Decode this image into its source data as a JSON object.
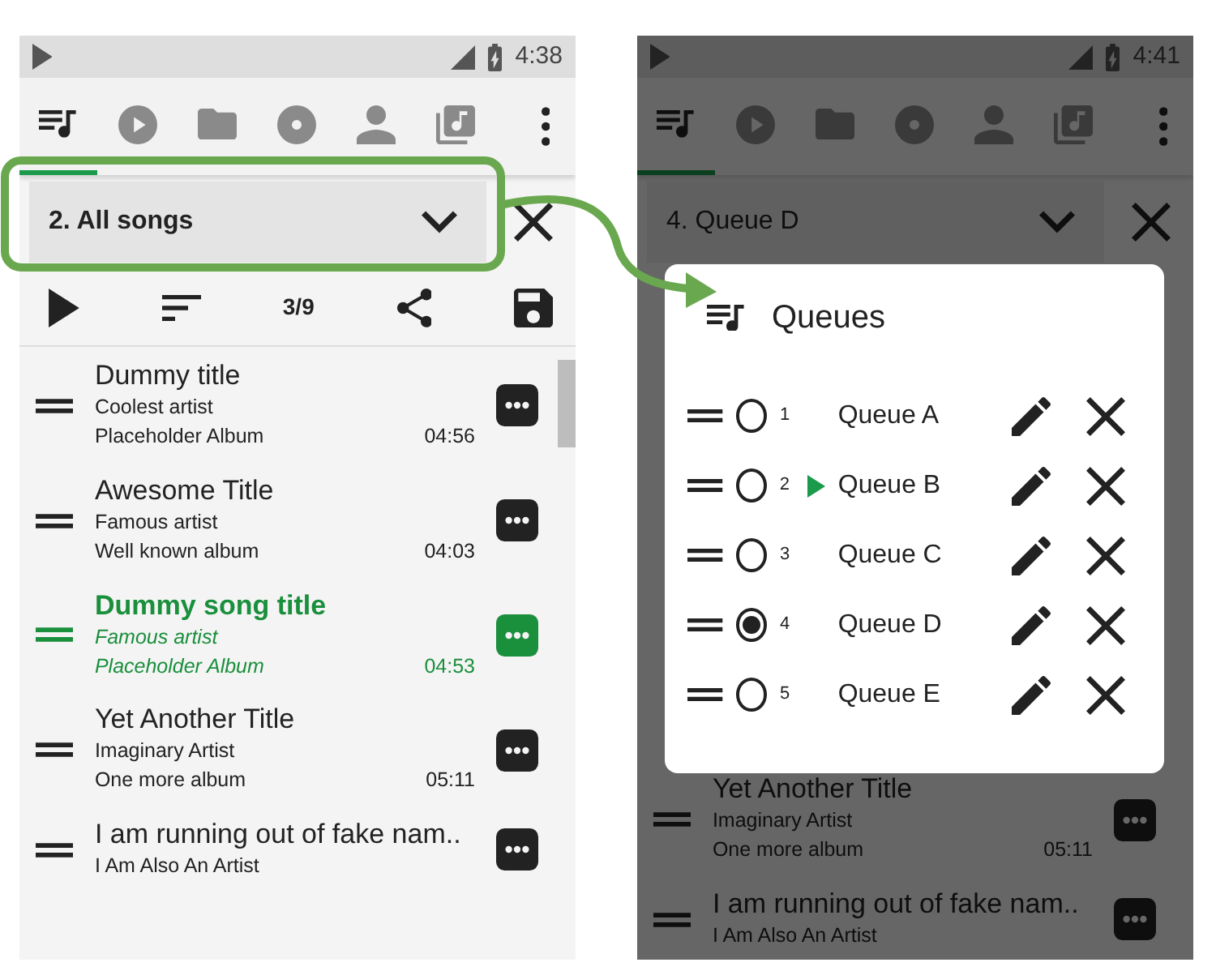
{
  "phones": [
    {
      "status_bar": {
        "time": "4:38"
      },
      "tabs": [
        {
          "kind": "queue",
          "selected": true
        },
        {
          "kind": "play",
          "selected": false
        },
        {
          "kind": "folder",
          "selected": false
        },
        {
          "kind": "album",
          "selected": false
        },
        {
          "kind": "artist",
          "selected": false
        },
        {
          "kind": "playlist",
          "selected": false
        }
      ],
      "queue_selector": {
        "value": "2. All songs",
        "emphasized": true
      },
      "controls": {
        "position": "3/9"
      },
      "songs": [
        {
          "title": "Dummy title",
          "artist": "Coolest artist",
          "album": "Placeholder Album",
          "duration": "04:56",
          "playing": false
        },
        {
          "title": "Awesome Title",
          "artist": "Famous artist",
          "album": "Well known album",
          "duration": "04:03",
          "playing": false
        },
        {
          "title": "Dummy song title",
          "artist": "Famous artist",
          "album": "Placeholder Album",
          "duration": "04:53",
          "playing": true
        },
        {
          "title": "Yet Another Title",
          "artist": "Imaginary Artist",
          "album": "One more album",
          "duration": "05:11",
          "playing": false
        },
        {
          "title": "I am running out of fake nam..",
          "artist": "I Am Also An Artist",
          "playing": false
        }
      ]
    },
    {
      "status_bar": {
        "time": "4:41"
      },
      "tabs": [
        {
          "kind": "queue",
          "selected": true
        },
        {
          "kind": "play",
          "selected": false
        },
        {
          "kind": "folder",
          "selected": false
        },
        {
          "kind": "album",
          "selected": false
        },
        {
          "kind": "artist",
          "selected": false
        },
        {
          "kind": "playlist",
          "selected": false
        }
      ],
      "queue_selector": {
        "value": "4. Queue D",
        "emphasized": false
      },
      "songs": [
        {
          "title": "Yet Another Title",
          "artist": "Imaginary Artist",
          "album": "One more album",
          "duration": "05:11",
          "playing": false
        },
        {
          "title": "I am running out of fake nam..",
          "artist": "I Am Also An Artist",
          "playing": false
        }
      ],
      "dialog": {
        "title": "Queues",
        "queues": [
          {
            "number": "1",
            "name": "Queue A",
            "selected": false,
            "playing": false
          },
          {
            "number": "2",
            "name": "Queue B",
            "selected": false,
            "playing": true
          },
          {
            "number": "3",
            "name": "Queue C",
            "selected": false,
            "playing": false
          },
          {
            "number": "4",
            "name": "Queue D",
            "selected": true,
            "playing": false
          },
          {
            "number": "5",
            "name": "Queue E",
            "selected": false,
            "playing": false
          }
        ]
      }
    }
  ]
}
